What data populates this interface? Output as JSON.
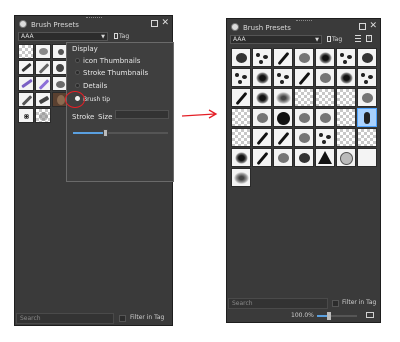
{
  "left_panel": {
    "title": "Brush Presets",
    "preset_combo": "AAA",
    "tag_label": "Tag",
    "search_placeholder": "Search",
    "filter_label": "Filter in Tag"
  },
  "view_popup": {
    "display_heading": "Display",
    "options": [
      {
        "label": "icon Thumbnails",
        "selected": false
      },
      {
        "label": "Stroke Thumbnails",
        "selected": false
      },
      {
        "label": "Details",
        "selected": false
      },
      {
        "label": "Brush tip",
        "selected": true
      }
    ],
    "stroke_label": "Stroke",
    "size_label": "Size",
    "size_level_fraction": 0.34
  },
  "right_panel": {
    "title": "Brush Presets",
    "preset_combo": "AAA",
    "tag_label": "Tag",
    "search_placeholder": "Search",
    "filter_label": "Filter in Tag",
    "zoom_readout": "100.0%",
    "zoom_level_fraction": 0.3
  },
  "icons": {
    "panel_logo": "krita-logo-icon",
    "float": "float-window-icon",
    "close": "close-icon",
    "tag": "tag-icon",
    "menu": "hamburger-menu-icon",
    "import": "import-icon",
    "arrow": "red-arrow-icon"
  },
  "colors": {
    "panel_bg": "#3a3a3a",
    "highlight_circle": "#e41f26",
    "selected_tip": "#a9d2ff",
    "slider_accent": "#5aa0e0"
  }
}
